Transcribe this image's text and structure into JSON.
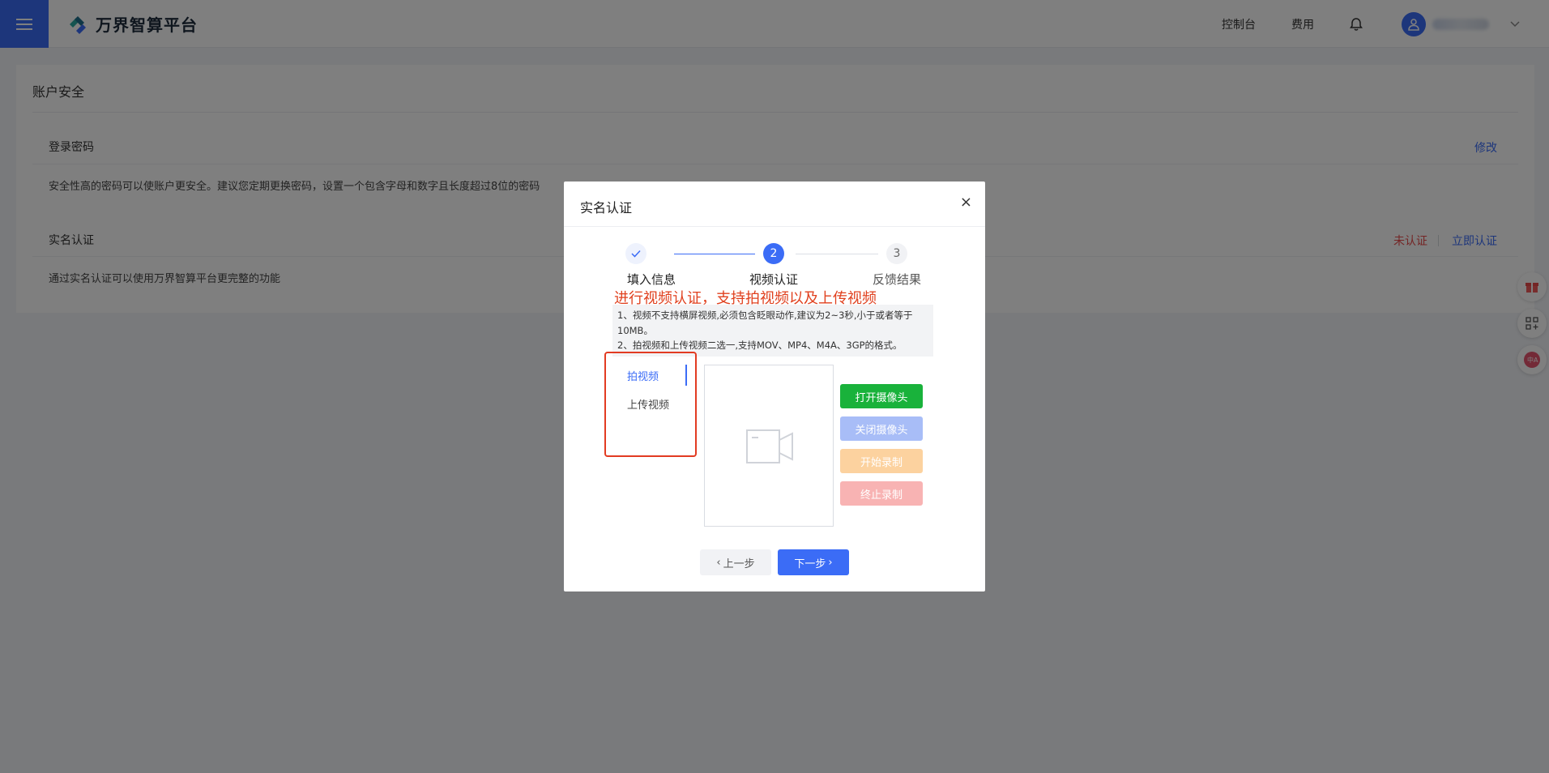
{
  "topbar": {
    "brand": "万界智算平台",
    "console": "控制台",
    "fee": "费用"
  },
  "account": {
    "title": "账户安全",
    "password": {
      "label": "登录密码",
      "action": "修改",
      "description": "安全性高的密码可以使账户更安全。建议您定期更换密码，设置一个包含字母和数字且长度超过8位的密码"
    },
    "realname": {
      "label": "实名认证",
      "status": "未认证",
      "action": "立即认证",
      "description": "通过实名认证可以使用万界智算平台更完整的功能"
    }
  },
  "modal": {
    "title": "实名认证",
    "close": "×",
    "steps": [
      {
        "number": "1",
        "label": "填入信息",
        "state": "done"
      },
      {
        "number": "2",
        "label": "视频认证",
        "state": "active"
      },
      {
        "number": "3",
        "label": "反馈结果",
        "state": "pending"
      }
    ],
    "annotation": "进行视频认证，支持拍视频以及上传视频",
    "notice": [
      "1、视频不支持横屏视频,必须包含眨眼动作,建议为2~3秒,小于或者等于10MB。",
      "2、拍视频和上传视频二选一,支持MOV、MP4、M4A、3GP的格式。"
    ],
    "tabs": {
      "record": "拍视频",
      "upload": "上传视频",
      "active": "record"
    },
    "buttons": {
      "open_camera": "打开摄像头",
      "close_camera": "关闭摄像头",
      "start_record": "开始录制",
      "stop_record": "终止录制",
      "prev": "上一步",
      "next": "下一步"
    },
    "colors": {
      "primary": "#3b6cf6",
      "open": "#19b23b",
      "annotation": "#e0401e"
    }
  }
}
